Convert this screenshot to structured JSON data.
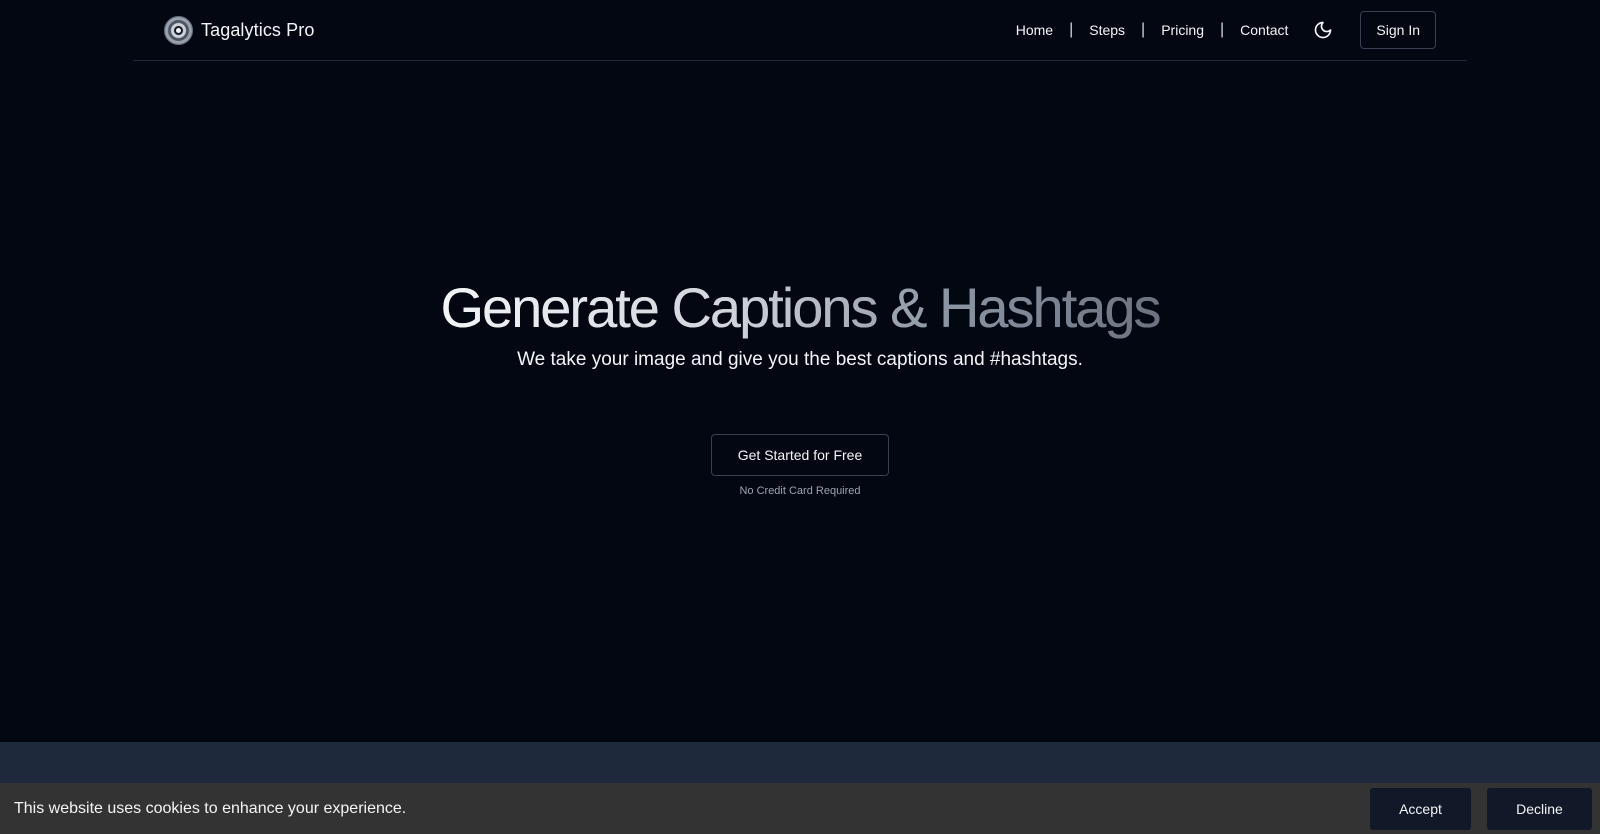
{
  "header": {
    "brand_name": "Tagalytics Pro",
    "logo_icon": "brand-logo-icon",
    "nav": [
      {
        "label": "Home"
      },
      {
        "label": "Steps"
      },
      {
        "label": "Pricing"
      },
      {
        "label": "Contact"
      }
    ],
    "separator": "|",
    "theme_toggle_icon": "moon-icon",
    "signin_label": "Sign In"
  },
  "hero": {
    "title": "Generate Captions & Hashtags",
    "subtitle": "We take your image and give you the best captions and #hashtags.",
    "cta_label": "Get Started for Free",
    "cta_note": "No Credit Card Required"
  },
  "cookie_banner": {
    "text": "This website uses cookies to enhance your experience.",
    "accept_label": "Accept",
    "decline_label": "Decline"
  },
  "colors": {
    "background": "#030712",
    "section_strip": "#1e293b",
    "cookie_background": "#333333",
    "button_dark": "#111827",
    "border": "#374151"
  }
}
